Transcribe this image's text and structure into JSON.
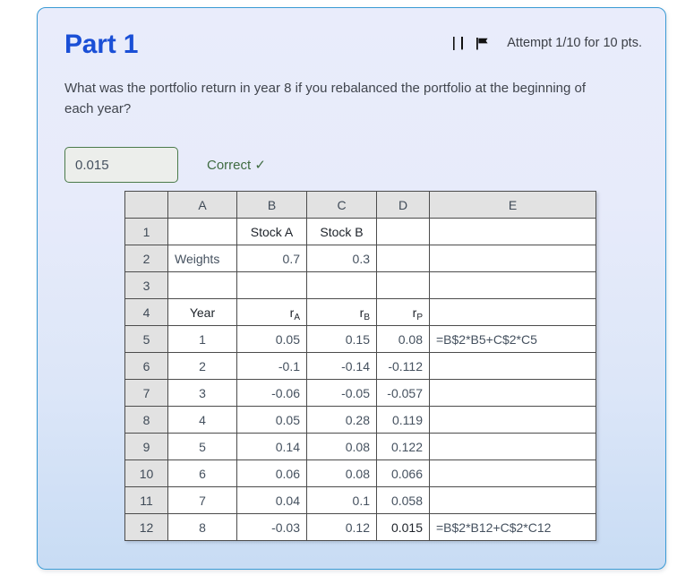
{
  "panel": {
    "title": "Part 1",
    "attempt_label": "Attempt 1/10 for 10 pts.",
    "icons": [
      "book-icon",
      "flag-icon"
    ],
    "border_color": "#3a9ad4",
    "title_color": "#1a4fd6"
  },
  "question": {
    "text": "What was the portfolio return in year 8 if you rebalanced the portfolio at the beginning of each year?"
  },
  "answer": {
    "value": "0.015",
    "placeholder": "",
    "status": "Correct ✓",
    "status_color": "#3f6b41",
    "input_border_color": "#4a7a4a"
  },
  "spreadsheet": {
    "column_headers": [
      "",
      "A",
      "B",
      "C",
      "D",
      "E"
    ],
    "rows": [
      {
        "n": "1",
        "a": "",
        "b": "Stock A",
        "c": "Stock B",
        "d": "",
        "e": ""
      },
      {
        "n": "2",
        "a": "Weights",
        "b": "0.7",
        "c": "0.3",
        "d": "",
        "e": ""
      },
      {
        "n": "3",
        "a": "",
        "b": "",
        "c": "",
        "d": "",
        "e": ""
      },
      {
        "n": "4",
        "a": "Year",
        "b": "rA",
        "c": "rB",
        "d": "rP",
        "e": ""
      },
      {
        "n": "5",
        "a": "1",
        "b": "0.05",
        "c": "0.15",
        "d": "0.08",
        "e": "=B$2*B5+C$2*C5"
      },
      {
        "n": "6",
        "a": "2",
        "b": "-0.1",
        "c": "-0.14",
        "d": "-0.112",
        "e": ""
      },
      {
        "n": "7",
        "a": "3",
        "b": "-0.06",
        "c": "-0.05",
        "d": "-0.057",
        "e": ""
      },
      {
        "n": "8",
        "a": "4",
        "b": "0.05",
        "c": "0.28",
        "d": "0.119",
        "e": ""
      },
      {
        "n": "9",
        "a": "5",
        "b": "0.14",
        "c": "0.08",
        "d": "0.122",
        "e": ""
      },
      {
        "n": "10",
        "a": "6",
        "b": "0.06",
        "c": "0.08",
        "d": "0.066",
        "e": ""
      },
      {
        "n": "11",
        "a": "7",
        "b": "0.04",
        "c": "0.1",
        "d": "0.058",
        "e": ""
      },
      {
        "n": "12",
        "a": "8",
        "b": "-0.03",
        "c": "0.12",
        "d": "0.015",
        "e": "=B$2*B12+C$2*C12"
      }
    ],
    "subscripts": {
      "r4b": "A",
      "r4c": "B",
      "r4d": "P"
    }
  }
}
